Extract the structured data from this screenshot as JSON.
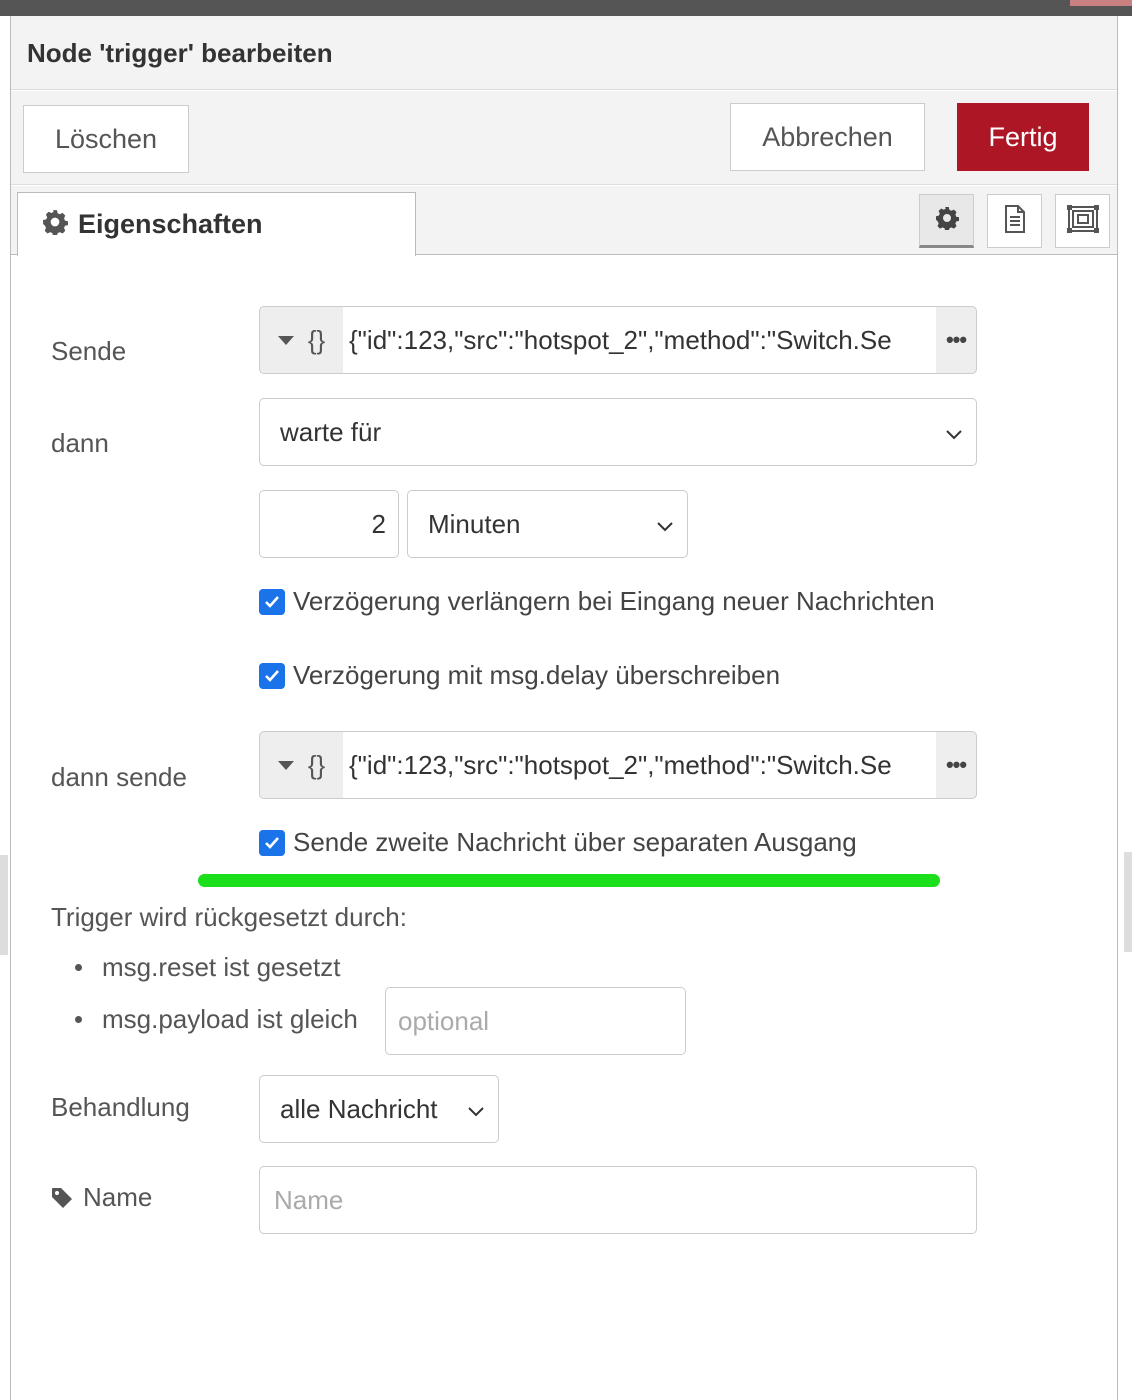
{
  "tray": {
    "title": "Node 'trigger' bearbeiten",
    "buttons": {
      "delete_label": "Löschen",
      "cancel_label": "Abbrechen",
      "done_label": "Fertig"
    },
    "tabs": {
      "properties_label": "Eigenschaften",
      "icons": [
        "gear-icon",
        "document-icon",
        "frame-icon"
      ]
    }
  },
  "form": {
    "send": {
      "label": "Sende",
      "type_glyph": "{}",
      "value": "{\"id\":123,\"src\":\"hotspot_2\",\"method\":\"Switch.Se",
      "expand_glyph": "•••"
    },
    "then": {
      "label": "dann",
      "selected": "warte für"
    },
    "duration": {
      "value": "2",
      "unit_selected": "Minuten"
    },
    "checkboxes": {
      "extend_delay": {
        "label": "Verzögerung verlängern bei Eingang neuer Nachrichten",
        "checked": true
      },
      "override_delay": {
        "label": "Verzögerung mit msg.delay überschreiben",
        "checked": true
      },
      "second_output": {
        "label": "Sende zweite Nachricht über separaten Ausgang",
        "checked": true
      }
    },
    "then_send": {
      "label": "dann sende",
      "type_glyph": "{}",
      "value": "{\"id\":123,\"src\":\"hotspot_2\",\"method\":\"Switch.Se",
      "expand_glyph": "•••"
    },
    "reset": {
      "heading": "Trigger wird rückgesetzt durch:",
      "item_reset": "msg.reset ist gesetzt",
      "item_payload": "msg.payload ist gleich",
      "payload_placeholder": "optional"
    },
    "handling": {
      "label": "Behandlung",
      "selected": "alle Nachricht"
    },
    "name": {
      "label": "Name",
      "placeholder": "Name"
    }
  },
  "colors": {
    "done_button": "#ad1625",
    "checkbox": "#1a73e8",
    "highlight_line": "#1adf1a"
  }
}
